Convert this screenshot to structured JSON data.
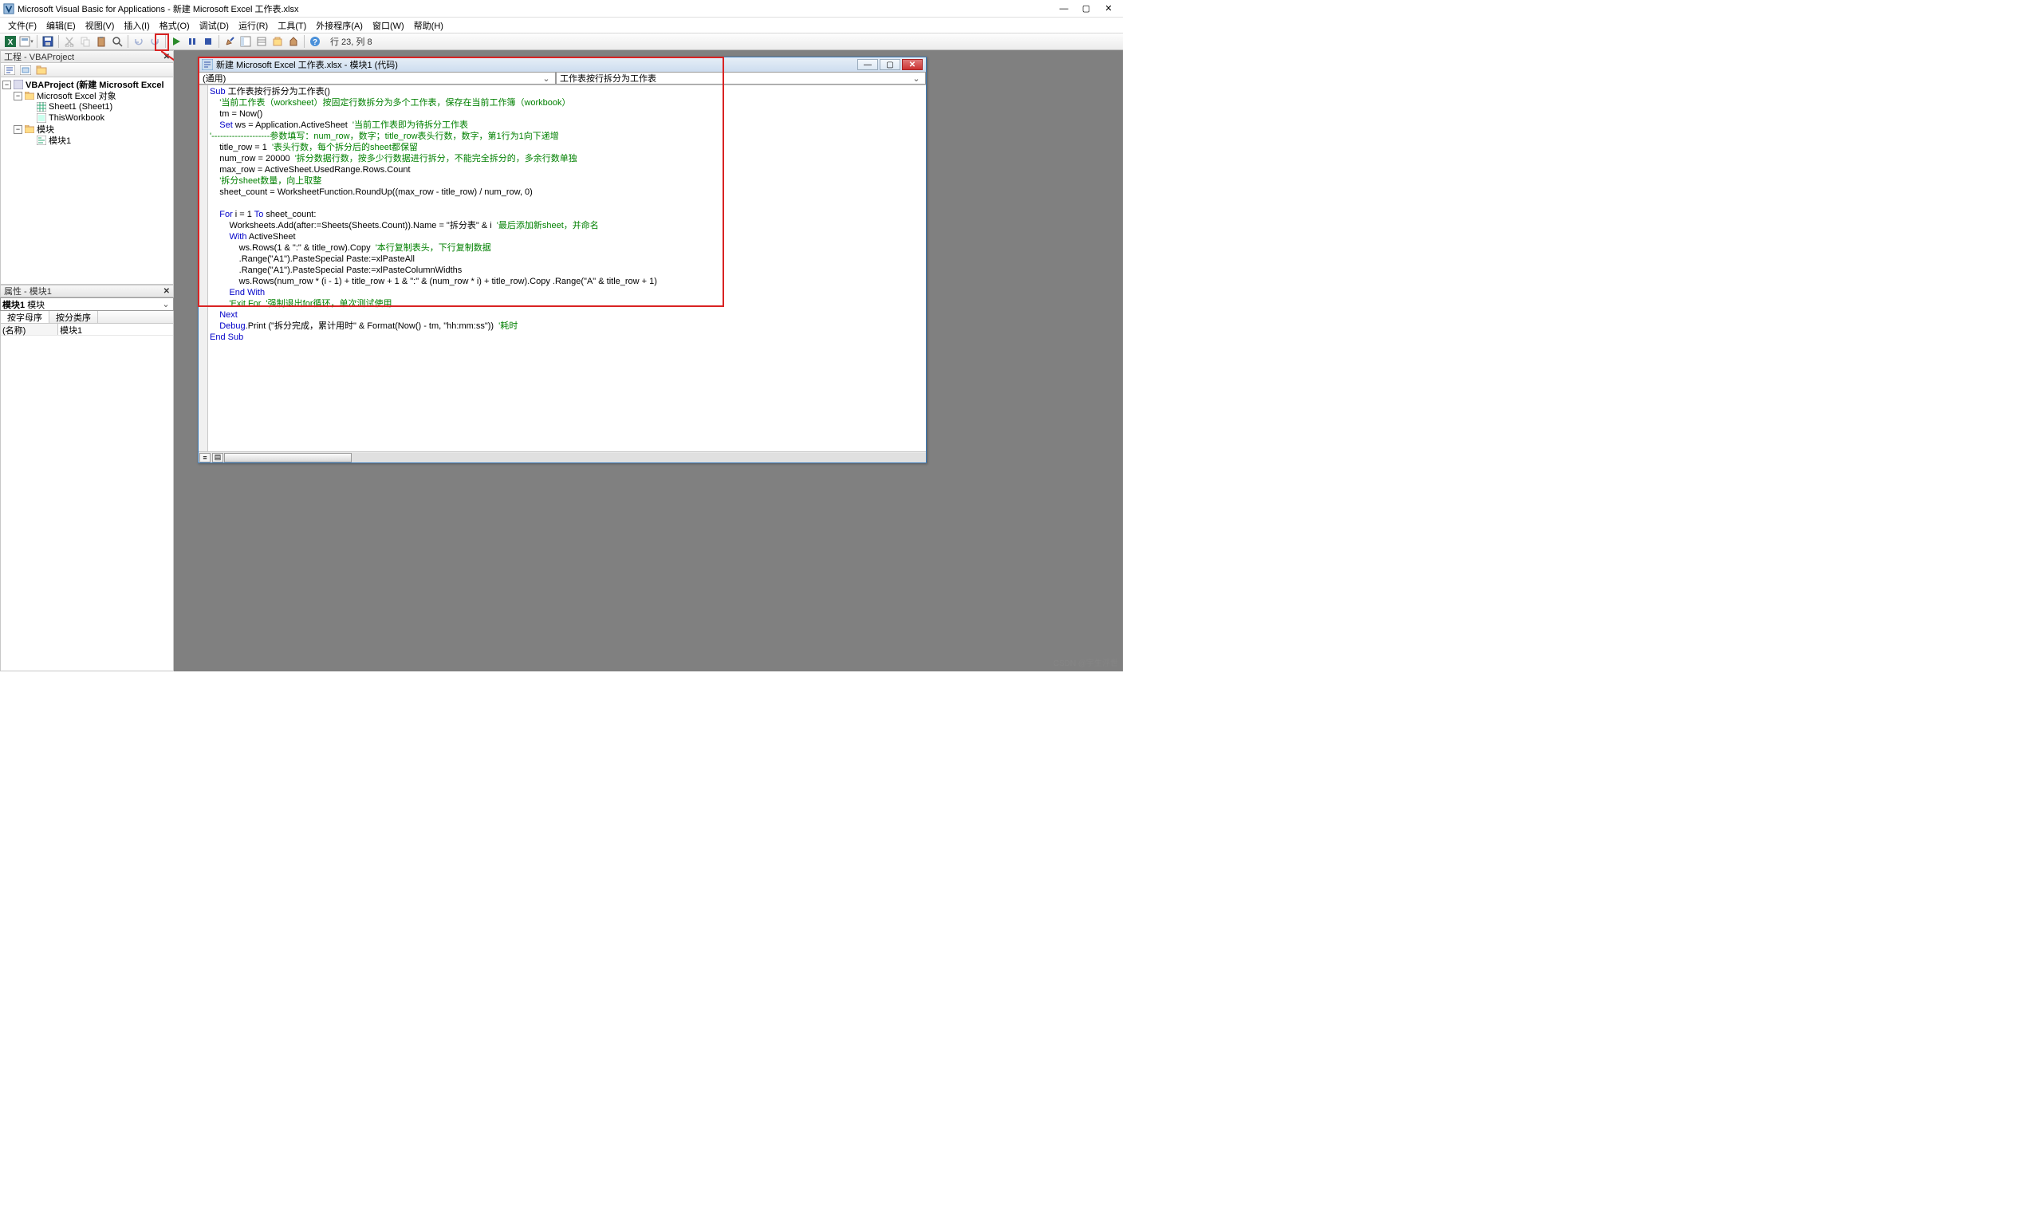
{
  "titlebar": {
    "app_title": "Microsoft Visual Basic for Applications - 新建 Microsoft Excel 工作表.xlsx"
  },
  "menus": {
    "file": "文件(F)",
    "edit": "编辑(E)",
    "view": "视图(V)",
    "insert": "插入(I)",
    "format": "格式(O)",
    "debug": "调试(D)",
    "run": "运行(R)",
    "tools": "工具(T)",
    "addins": "外接程序(A)",
    "window": "窗口(W)",
    "help": "帮助(H)"
  },
  "toolbar": {
    "status": "行 23, 列 8",
    "icons": {
      "excel": "excel-icon",
      "insert_uf": "insert-userform-icon",
      "save": "save-icon",
      "cut": "cut-icon",
      "copy": "copy-icon",
      "paste": "paste-icon",
      "find": "find-icon",
      "undo": "undo-icon",
      "redo": "redo-icon",
      "run": "play-icon",
      "break": "pause-icon",
      "reset": "stop-icon",
      "design": "design-mode-icon",
      "explorer": "project-explorer-icon",
      "props": "properties-window-icon",
      "browser": "object-browser-icon",
      "toolbox": "toolbox-icon",
      "help": "help-icon"
    }
  },
  "project_panel": {
    "title": "工程 - VBAProject",
    "toolbar": {
      "view_code": "view-code-icon",
      "view_object": "view-object-icon",
      "folders": "toggle-folders-icon"
    },
    "tree": {
      "root": "VBAProject (新建 Microsoft Excel",
      "folder_objects": "Microsoft Excel 对象",
      "sheet1": "Sheet1 (Sheet1)",
      "thiswb": "ThisWorkbook",
      "folder_modules": "模块",
      "module1": "模块1"
    }
  },
  "props_panel": {
    "title": "属性 - 模块1",
    "combo_name": "模块1",
    "combo_type": "模块",
    "tab_alpha": "按字母序",
    "tab_cat": "按分类序",
    "row_name_key": "(名称)",
    "row_name_val": "模块1"
  },
  "code_window": {
    "title": "新建 Microsoft Excel 工作表.xlsx - 模块1 (代码)",
    "dd_left": "(通用)",
    "dd_right": "工作表按行拆分为工作表"
  },
  "code": {
    "l01a": "Sub",
    "l01b": " 工作表按行拆分为工作表()",
    "l02": "    '当前工作表（worksheet）按固定行数拆分为多个工作表，保存在当前工作簿（workbook）",
    "l03": "    tm = Now()",
    "l04a": "    ",
    "l04b": "Set",
    "l04c": " ws = Application.ActiveSheet  ",
    "l04d": "'当前工作表即为待拆分工作表",
    "l05": "'--------------------参数填写：num_row，数字；title_row表头行数，数字，第1行为1向下递增",
    "l06a": "    title_row = 1  ",
    "l06b": "'表头行数，每个拆分后的sheet都保留",
    "l07a": "    num_row = 20000  ",
    "l07b": "'拆分数据行数，按多少行数据进行拆分，不能完全拆分的，多余行数单独",
    "l08": "    max_row = ActiveSheet.UsedRange.Rows.Count",
    "l09": "    '拆分sheet数量，向上取整",
    "l10": "    sheet_count = WorksheetFunction.RoundUp((max_row - title_row) / num_row, 0)",
    "l11": "    ",
    "l12a": "    ",
    "l12b": "For",
    "l12c": " i = 1 ",
    "l12d": "To",
    "l12e": " sheet_count:",
    "l13a": "        Worksheets.Add(after:=Sheets(Sheets.Count)).Name = \"拆分表\" & i  ",
    "l13b": "'最后添加新sheet，并命名",
    "l14a": "        ",
    "l14b": "With",
    "l14c": " ActiveSheet",
    "l15a": "            ws.Rows(1 & \":\" & title_row).Copy  ",
    "l15b": "'本行复制表头，下行复制数据",
    "l16": "            .Range(\"A1\").PasteSpecial Paste:=xlPasteAll",
    "l17": "            .Range(\"A1\").PasteSpecial Paste:=xlPasteColumnWidths",
    "l18": "            ws.Rows(num_row * (i - 1) + title_row + 1 & \":\" & (num_row * i) + title_row).Copy .Range(\"A\" & title_row + 1)",
    "l19a": "        ",
    "l19b": "End With",
    "l20a": "        ",
    "l20b": "'Exit For  '强制退出for循环，单次测试使用",
    "l21a": "    ",
    "l21b": "Next",
    "l22a": "    ",
    "l22b": "Debug",
    "l22c": ".Print (\"拆分完成，累计用时\" & Format(Now() - tm, \"hh:mm:ss\"))  ",
    "l22d": "'耗时",
    "l23a": "End Sub"
  },
  "watermark": "CSDN @宇生浮世"
}
